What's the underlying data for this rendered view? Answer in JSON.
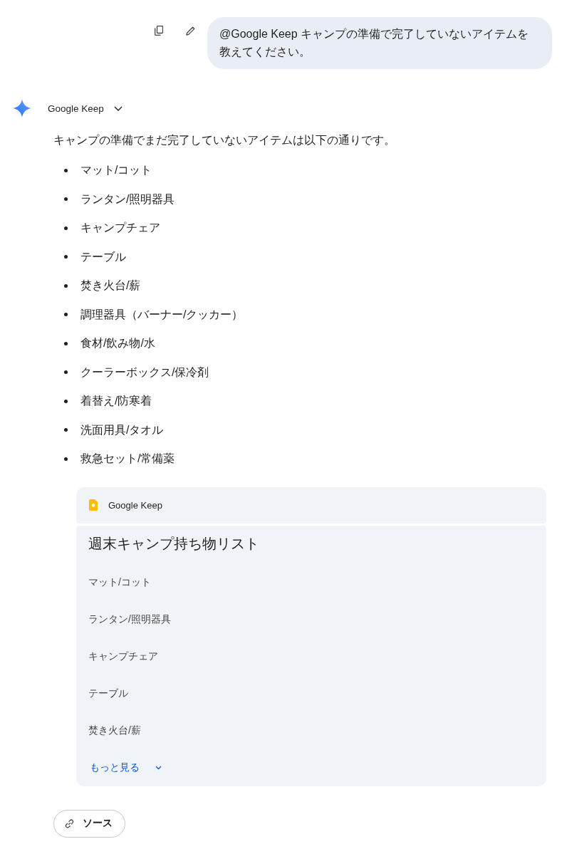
{
  "user_message": {
    "text": "@Google Keep キャンプの準備で完了していないアイテムを教えてください。"
  },
  "response": {
    "app_selector": {
      "label": "Google Keep"
    },
    "intro": "キャンプの準備でまだ完了していないアイテムは以下の通りです。",
    "items": [
      "マット/コット",
      "ランタン/照明器具",
      "キャンプチェア",
      "テーブル",
      "焚き火台/薪",
      "調理器具（バーナー/クッカー）",
      "食材/飲み物/水",
      "クーラーボックス/保冷剤",
      "着替え/防寒着",
      "洗面用具/タオル",
      "救急セット/常備薬"
    ],
    "keep_card": {
      "app_name": "Google Keep",
      "title": "週末キャンプ持ち物リスト",
      "items": [
        "マット/コット",
        "ランタン/照明器具",
        "キャンプチェア",
        "テーブル",
        "焚き火台/薪"
      ],
      "more_label": "もっと見る"
    },
    "sources_button": {
      "label": "ソース"
    }
  }
}
